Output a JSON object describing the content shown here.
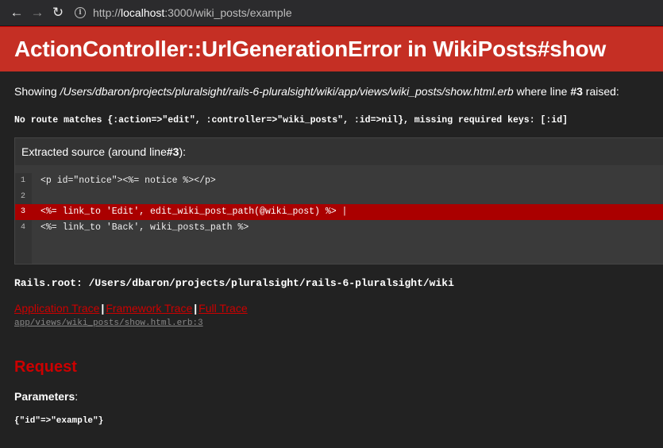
{
  "browser": {
    "back_icon": "arrow-left-icon",
    "forward_icon": "arrow-right-icon",
    "reload_icon": "reload-icon",
    "url_scheme": "http://",
    "url_host": "localhost",
    "url_rest": ":3000/wiki_posts/example"
  },
  "error": {
    "title": "ActionController::UrlGenerationError in WikiPosts#show"
  },
  "showing": {
    "prefix": "Showing ",
    "path": "/Users/dbaron/projects/pluralsight/rails-6-pluralsight/wiki/app/views/wiki_posts/show.html.erb",
    "middle": " where line ",
    "line": "#3",
    "suffix": " raised:"
  },
  "message": "No route matches {:action=>\"edit\", :controller=>\"wiki_posts\", :id=>nil}, missing required keys: [:id]",
  "source": {
    "title_prefix": "Extracted source (around line ",
    "title_line": "#3",
    "title_suffix": "):",
    "lines": [
      {
        "num": "1",
        "code": "<p id=\"notice\"><%= notice %></p>"
      },
      {
        "num": "2",
        "code": ""
      },
      {
        "num": "3",
        "code": "<%= link_to 'Edit', edit_wiki_post_path(@wiki_post) %> |"
      },
      {
        "num": "4",
        "code": "<%= link_to 'Back', wiki_posts_path %>"
      }
    ]
  },
  "rails_root": "Rails.root: /Users/dbaron/projects/pluralsight/rails-6-pluralsight/wiki",
  "traces": {
    "application": "Application Trace",
    "framework": "Framework Trace",
    "full": "Full Trace",
    "separator": "|",
    "file": "app/views/wiki_posts/show.html.erb:3"
  },
  "request": {
    "heading": "Request",
    "params_label": "Parameters",
    "params_colon": ":",
    "params_value": "{\"id\"=>\"example\"}"
  }
}
